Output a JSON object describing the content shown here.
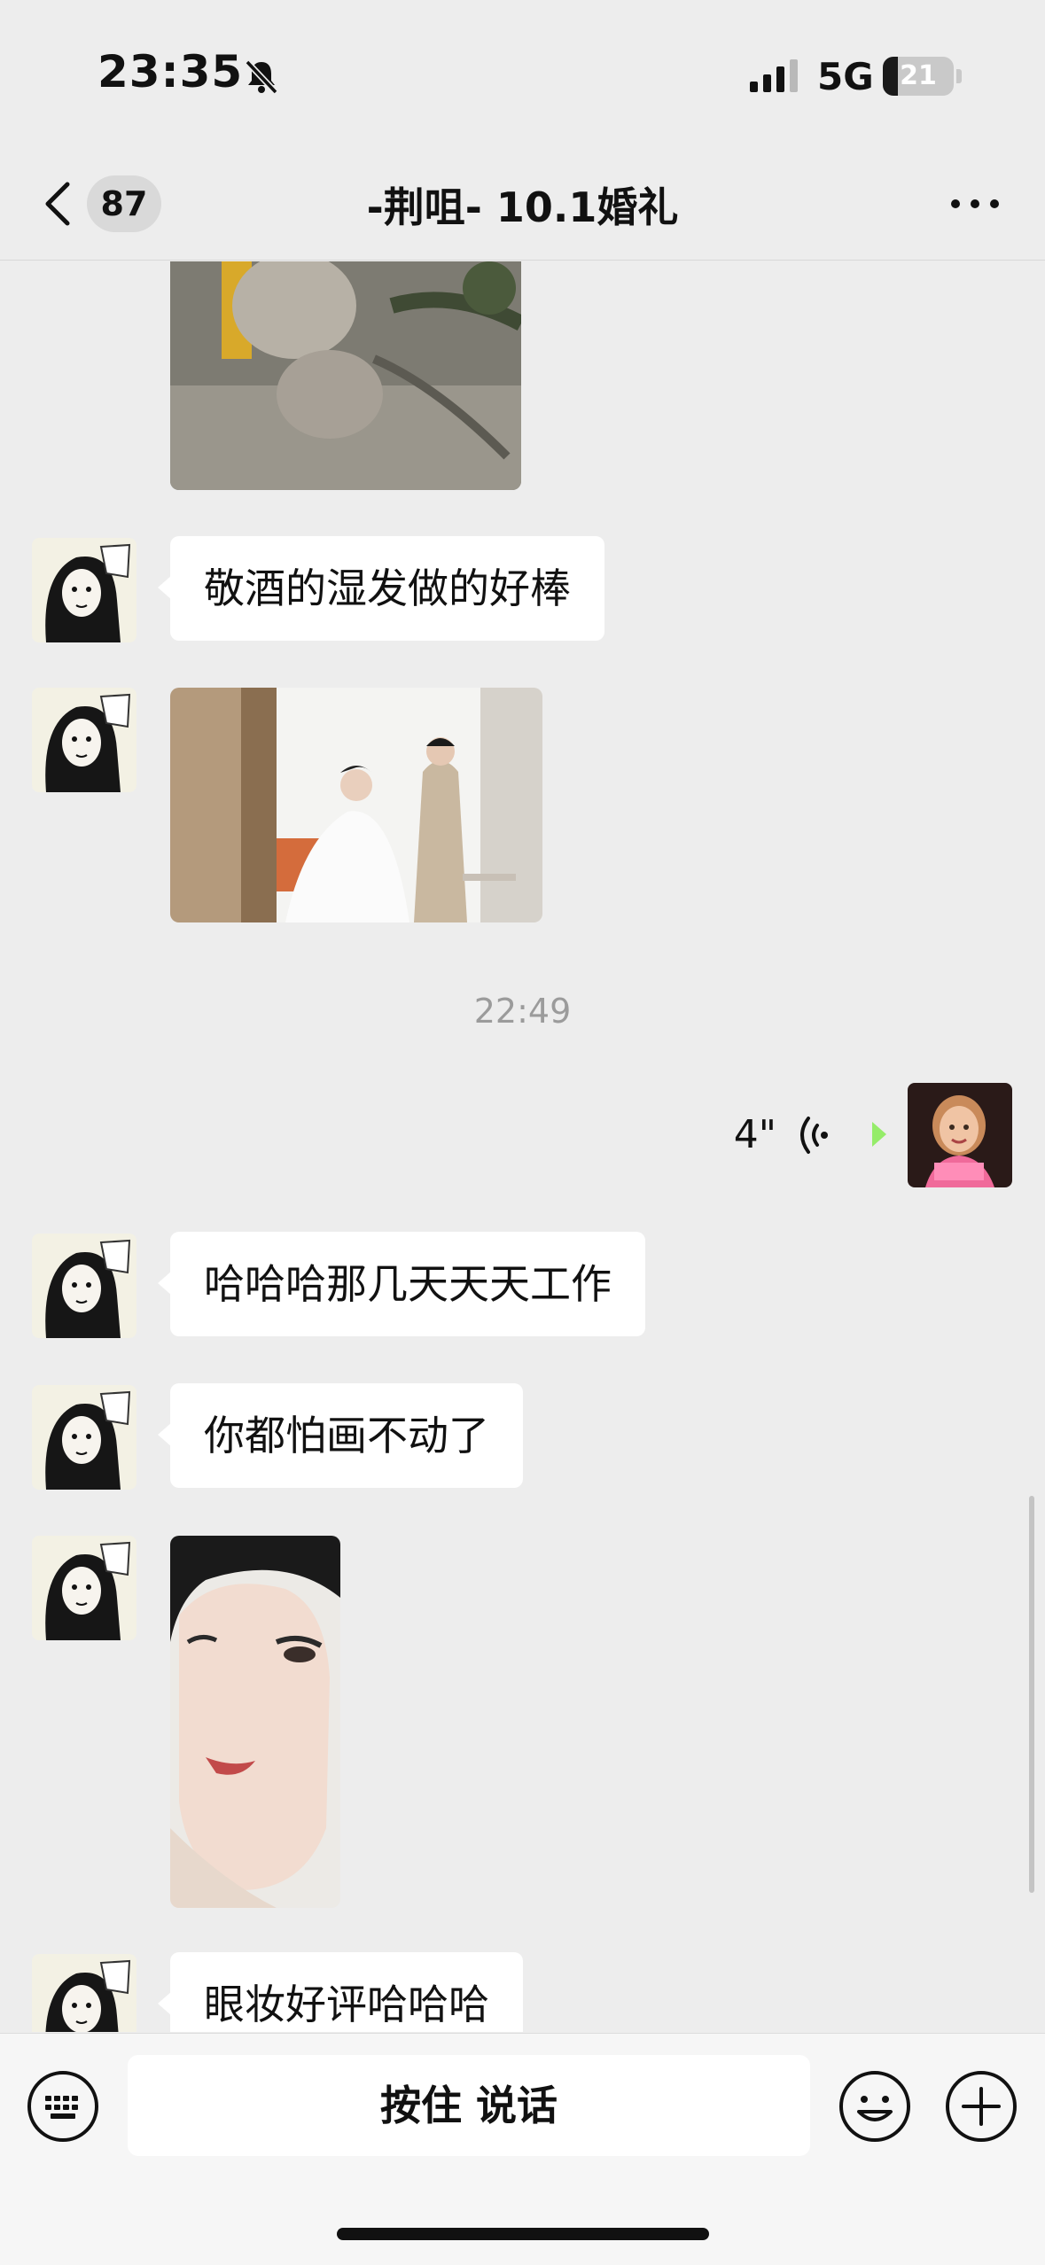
{
  "status_bar": {
    "time": "23:35",
    "network": "5G",
    "battery_percent": 21,
    "mute_icon": "bell-slash-icon",
    "signal_icon": "cellular-signal-icon"
  },
  "nav": {
    "unread_count": "87",
    "title": "-荆咀- 10.1婚礼",
    "back_icon": "chevron-left-icon",
    "more_icon": "ellipsis-icon"
  },
  "messages": [
    {
      "type": "image",
      "side": "incoming",
      "subject": "squirrel on tree branch"
    },
    {
      "type": "text",
      "side": "incoming",
      "text": "敬酒的湿发做的好棒"
    },
    {
      "type": "image",
      "side": "incoming",
      "subject": "bride getting ready with veil"
    },
    {
      "type": "time",
      "text": "22:49"
    },
    {
      "type": "voice",
      "side": "outgoing",
      "duration": "4\""
    },
    {
      "type": "text",
      "side": "incoming",
      "text": "哈哈哈那几天天天工作"
    },
    {
      "type": "text",
      "side": "incoming",
      "text": "你都怕画不动了"
    },
    {
      "type": "image",
      "side": "incoming",
      "subject": "bridal makeup portrait"
    },
    {
      "type": "text",
      "side": "incoming",
      "text": "眼妆好评哈哈哈"
    }
  ],
  "input_bar": {
    "hold_to_talk": "按住 说话",
    "keyboard_icon": "keyboard-icon",
    "emoji_icon": "smiley-icon",
    "plus_icon": "plus-circle-icon"
  },
  "colors": {
    "background": "#ededed",
    "outgoing_bubble": "#95ec69",
    "incoming_bubble": "#ffffff",
    "timestamp": "#9b9b9b"
  }
}
